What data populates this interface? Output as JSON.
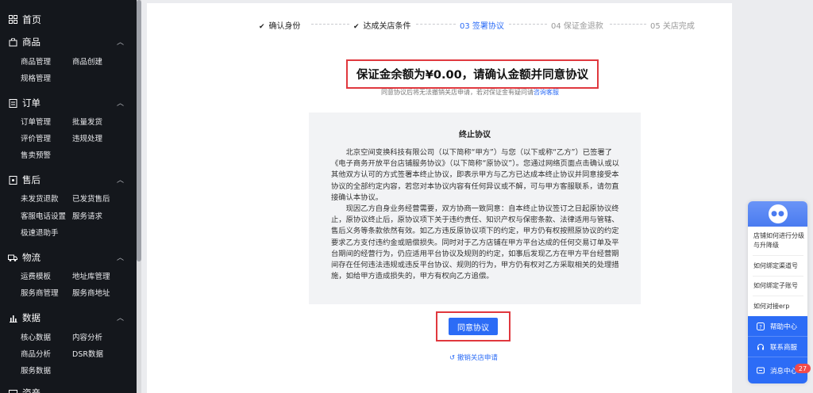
{
  "sidebar": {
    "home": "首页",
    "groups": [
      {
        "title": "商品",
        "items": [
          "商品管理",
          "商品创建",
          "规格管理"
        ]
      },
      {
        "title": "订单",
        "items": [
          "订单管理",
          "批量发货",
          "评价管理",
          "违规处理",
          "售卖预警"
        ]
      },
      {
        "title": "售后",
        "items": [
          "未发货退款",
          "已发货售后",
          "客服电话设置",
          "服务请求",
          "极速退助手"
        ]
      },
      {
        "title": "物流",
        "items": [
          "运费模板",
          "地址库管理",
          "服务商管理",
          "服务商地址"
        ]
      },
      {
        "title": "数据",
        "items": [
          "核心数据",
          "内容分析",
          "商品分析",
          "DSR数据",
          "服务数据"
        ]
      },
      {
        "title": "资产"
      }
    ]
  },
  "steps": [
    "确认身份",
    "达成关店条件",
    "03 签署协议",
    "04 保证金退款",
    "05 关店完成"
  ],
  "headline": "保证金余额为¥0.00，请确认金额并同意协议",
  "subnote": {
    "text": "同意协议后将无法撤销关店申请，若对保证金有疑问请",
    "link": "咨询客服"
  },
  "agreement": {
    "title": "终止协议",
    "p1": "北京空间变换科技有限公司（以下简称“甲方”）与您（以下或称“乙方”）已签署了《电子商务开放平台店铺服务协议》（以下简称“原协议”）。您通过网络页面点击确认或以其他双方认可的方式签署本终止协议，即表示甲方与乙方已达成本终止协议并同意接受本协议的全部约定内容，若您对本协议内容有任何异议或不解，可与甲方客服联系，请勿直接确认本协议。",
    "p2": "现因乙方自身业务经营需要，双方协商一致同意：自本终止协议签订之日起原协议终止，原协议终止后，原协议项下关于违约责任、知识产权与保密条款、法律适用与管辖、售后义务等条款依然有效。如乙方违反原协议项下的约定，甲方仍有权按照原协议的约定要求乙方支付违约金或赔偿损失。同时对于乙方店铺在甲方平台达成的任何交易订单及平台期间的经营行为，仍应适用平台协议及规则的约定，如事后发现乙方在甲方平台经营期间存在任何违法违规或违反平台协议、规则的行为，甲方仍有权对乙方采取相关的处理措施，如给甲方造成损失的，甲方有权向乙方追偿。"
  },
  "agree_button": "同意协议",
  "revoke_link": "撤销关店申请",
  "help_panel": {
    "faqs": [
      "店铺如何进行分级与升降级",
      "如何绑定渠道号",
      "如何绑定子账号",
      "如何对接erp"
    ],
    "actions": [
      "帮助中心",
      "联系商服",
      "消息中心"
    ],
    "badge": "27"
  },
  "colors": {
    "accent": "#2c6cf6",
    "highlight_border": "#e0383e",
    "sidebar_bg": "#14171c"
  }
}
